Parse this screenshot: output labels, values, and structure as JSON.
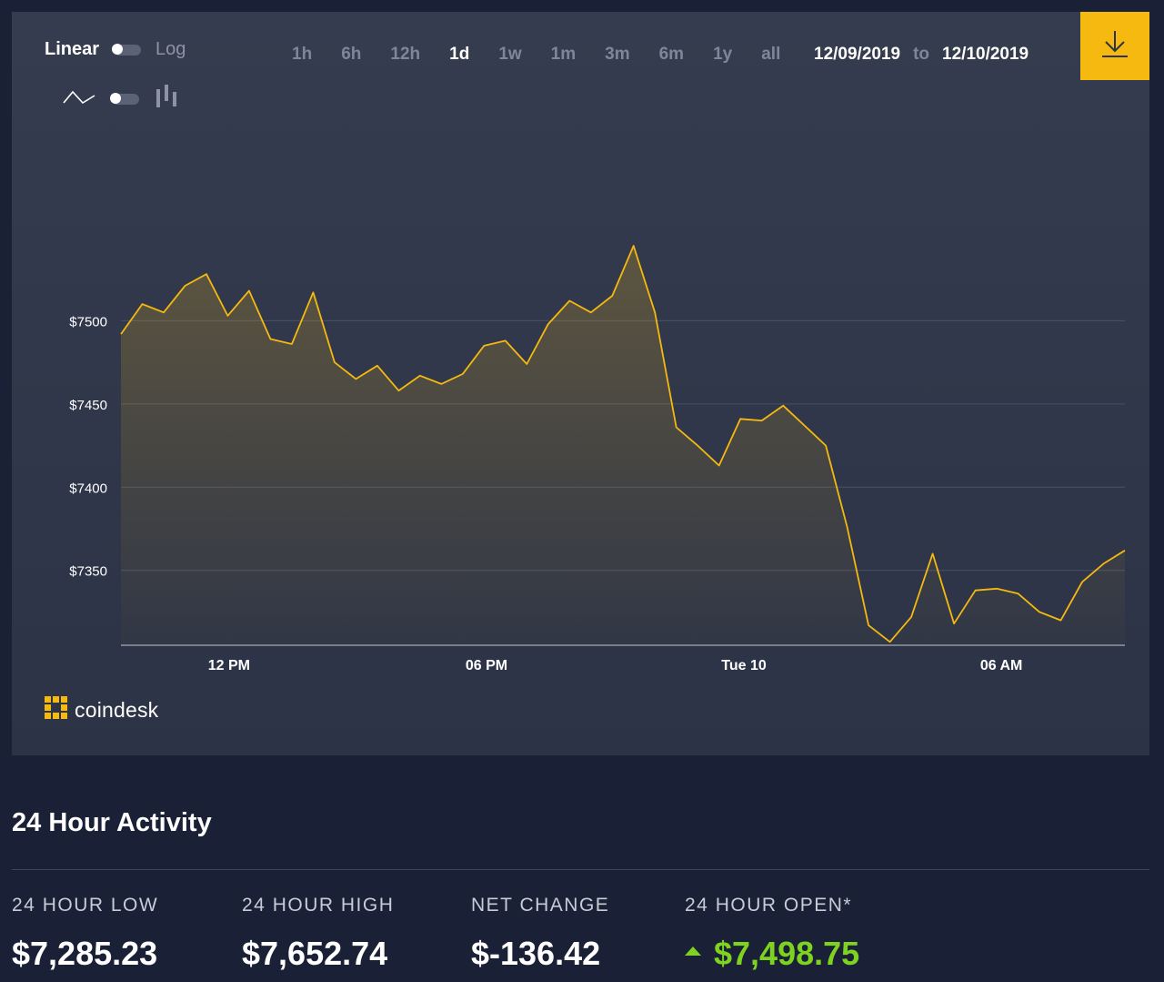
{
  "controls": {
    "scale_linear_label": "Linear",
    "scale_log_label": "Log",
    "chart_type_line_icon": "line-chart-icon",
    "chart_type_candle_icon": "candlestick-chart-icon",
    "ranges": [
      "1h",
      "6h",
      "12h",
      "1d",
      "1w",
      "1m",
      "3m",
      "6m",
      "1y",
      "all"
    ],
    "active_range": "1d",
    "date_from": "12/09/2019",
    "date_to_label": "to",
    "date_to": "12/10/2019",
    "download_icon": "download-icon"
  },
  "brand": {
    "name": "coindesk",
    "accent": "#f5b90f"
  },
  "chart_data": {
    "type": "area",
    "xlabel": "",
    "ylabel": "",
    "x_ticks": [
      "12 PM",
      "06 PM",
      "Tue 10",
      "06 AM"
    ],
    "y_ticks": [
      "$7500",
      "$7450",
      "$7400",
      "$7350"
    ],
    "ylim": [
      7305,
      7620
    ],
    "grid": true,
    "line_color": "#f5b90f",
    "x_hours": [
      0,
      0.5,
      1,
      1.5,
      2,
      2.5,
      3,
      3.5,
      4,
      4.5,
      5,
      5.5,
      6,
      6.5,
      7,
      7.5,
      8,
      8.5,
      9,
      9.5,
      10,
      10.5,
      11,
      11.5,
      12,
      12.5,
      13,
      13.5,
      14,
      14.5,
      15,
      15.5,
      16,
      16.5,
      17,
      17.5,
      18,
      18.5,
      19,
      19.5,
      20,
      20.5,
      21,
      21.5,
      22,
      22.5,
      23,
      23.5
    ],
    "values": [
      7492,
      7510,
      7505,
      7521,
      7528,
      7503,
      7518,
      7489,
      7486,
      7517,
      7475,
      7465,
      7473,
      7458,
      7467,
      7462,
      7468,
      7485,
      7488,
      7474,
      7498,
      7512,
      7505,
      7515,
      7545,
      7505,
      7436,
      7425,
      7413,
      7441,
      7440,
      7449,
      7437,
      7425,
      7376,
      7317,
      7307,
      7322,
      7360,
      7318,
      7338,
      7339,
      7336,
      7325,
      7320,
      7343,
      7354,
      7362
    ],
    "low_label": "$7,285.23",
    "high_label": "$7,652.74"
  },
  "activity": {
    "title": "24 Hour Activity",
    "stats": [
      {
        "label": "24 HOUR LOW",
        "value": "$7,285.23"
      },
      {
        "label": "24 HOUR HIGH",
        "value": "$7,652.74"
      },
      {
        "label": "NET CHANGE",
        "value": "$-136.42"
      },
      {
        "label": "24 HOUR OPEN*",
        "value": "$7,498.75"
      }
    ]
  }
}
